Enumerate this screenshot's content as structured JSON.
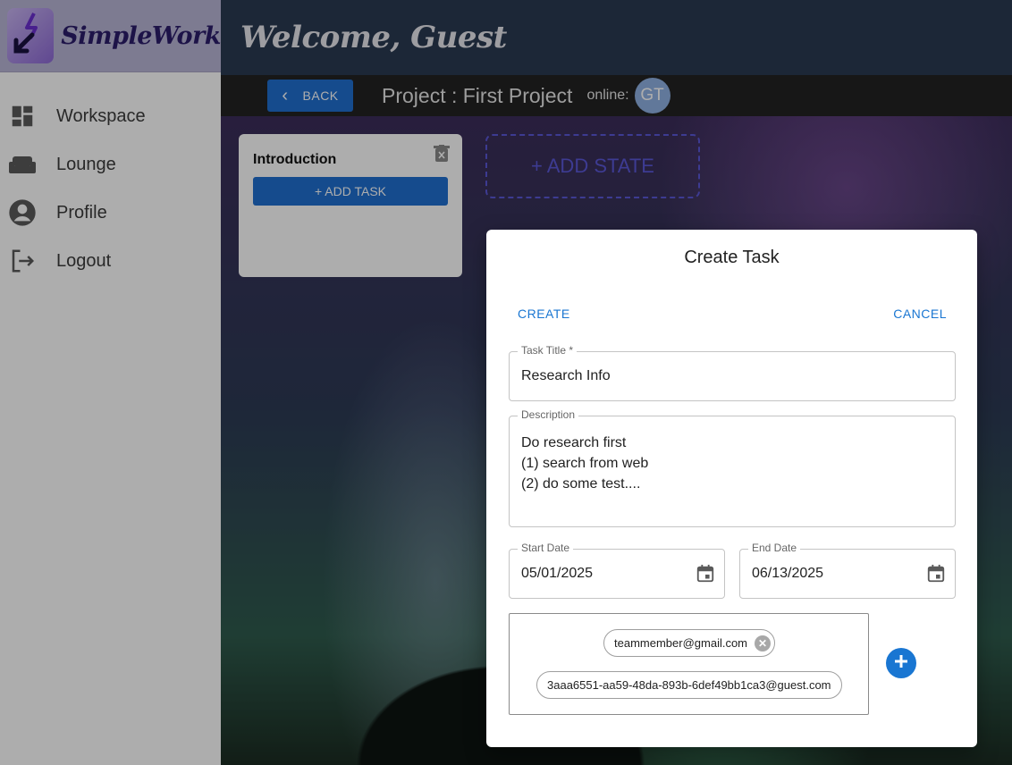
{
  "sidebar": {
    "brand": "SimpleWork",
    "items": [
      {
        "label": "Workspace",
        "icon": "dashboard-icon"
      },
      {
        "label": "Lounge",
        "icon": "sofa-icon"
      },
      {
        "label": "Profile",
        "icon": "account-circle-icon"
      },
      {
        "label": "Logout",
        "icon": "logout-icon"
      }
    ]
  },
  "header": {
    "welcome": "Welcome, Guest"
  },
  "project_bar": {
    "back_label": "BACK",
    "title": "Project : First Project",
    "online_label": "online:",
    "online_avatar": "GT"
  },
  "board": {
    "states": [
      {
        "title": "Introduction",
        "add_task_label": "+ ADD TASK"
      }
    ],
    "add_state_label": "+ ADD STATE"
  },
  "dialog": {
    "title": "Create Task",
    "create_label": "CREATE",
    "cancel_label": "CANCEL",
    "task_title": {
      "label": "Task Title *",
      "value": "Research Info"
    },
    "description": {
      "label": "Description",
      "value": "Do research first\n(1) search from web\n(2) do some test...."
    },
    "start_date": {
      "label": "Start Date",
      "value": "05/01/2025"
    },
    "end_date": {
      "label": "End Date",
      "value": "06/13/2025"
    },
    "assignees": [
      "teammember@gmail.com",
      "3aaa6551-aa59-48da-893b-6def49bb1ca3@guest.com"
    ]
  },
  "colors": {
    "accent": "#1976d2",
    "button_blue": "#1f6fd0",
    "add_state": "#5b58d8",
    "topbar": "#2a3a52"
  }
}
